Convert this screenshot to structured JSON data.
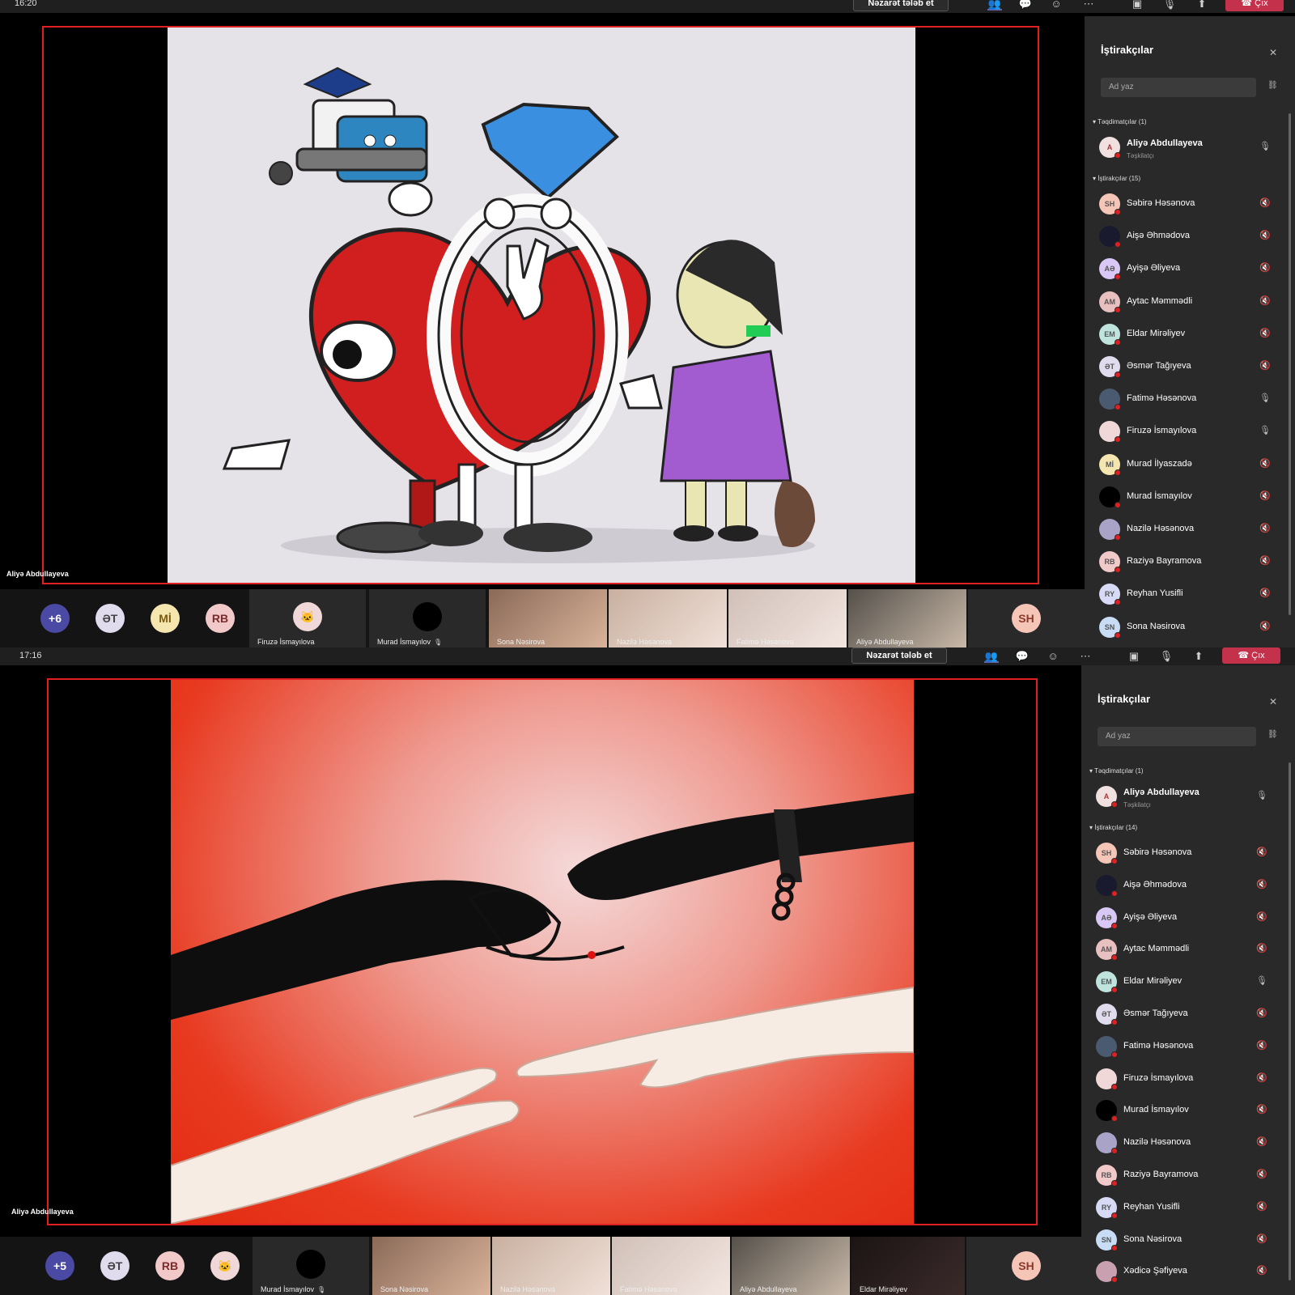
{
  "shot1": {
    "time": "16:20",
    "toolbar": {
      "request_control": "Nəzarət tələb et",
      "leave": "Çıx",
      "icons": [
        "people-icon",
        "chat-icon",
        "reactions-icon",
        "more-icon",
        "camera-off-icon",
        "mic-off-icon",
        "share-icon"
      ]
    },
    "presenter_label": "Aliyə Abdullayeva",
    "roster": {
      "overflow": "+6",
      "avatars": [
        "ƏT",
        "Mİ",
        "RB"
      ],
      "tiles": [
        {
          "name": "Firuzə İsmayılova"
        },
        {
          "name": "Murad İsmayılov"
        }
      ],
      "videos": [
        "Sona Nəsirova",
        "Nazilə Həsənova",
        "Fatimə Həsənova",
        "Aliyə Abdullayeva"
      ],
      "self": "SH"
    },
    "panel": {
      "title": "İştirakçılar",
      "search_placeholder": "Ad yaz",
      "presenters_header": "Təqdimatçılar (1)",
      "presenter": {
        "name": "Aliyə Abdullayeva",
        "role": "Təşkilatçı"
      },
      "attendees_header": "İştirakçılar (15)",
      "attendees": [
        {
          "initials": "SH",
          "name": "Səbirə Həsənova",
          "mic": "off",
          "color": "#f5c6b8"
        },
        {
          "initials": "",
          "name": "Aişə Əhmədova",
          "mic": "off",
          "color": "#1a1a2e"
        },
        {
          "initials": "AƏ",
          "name": "Ayişə Əliyeva",
          "mic": "off",
          "color": "#d9c8f5"
        },
        {
          "initials": "AM",
          "name": "Aytac Məmmədli",
          "mic": "off",
          "color": "#e8c0c0"
        },
        {
          "initials": "EM",
          "name": "Eldar Mirəliyev",
          "mic": "off",
          "color": "#bfe4dd"
        },
        {
          "initials": "ƏT",
          "name": "Əsmər Tağıyeva",
          "mic": "off",
          "color": "#e0dcee"
        },
        {
          "initials": "",
          "name": "Fatimə Həsənova",
          "mic": "on",
          "color": "#4a5a70"
        },
        {
          "initials": "",
          "name": "Firuzə İsmayılova",
          "mic": "on",
          "color": "#f0d8d8"
        },
        {
          "initials": "Mİ",
          "name": "Murad İlyaszadə",
          "mic": "off",
          "color": "#f5e6b0"
        },
        {
          "initials": "",
          "name": "Murad İsmayılov",
          "mic": "off",
          "color": "#000000"
        },
        {
          "initials": "",
          "name": "Nazilə Həsənova",
          "mic": "off",
          "color": "#a9a3c8"
        },
        {
          "initials": "RB",
          "name": "Raziyə Bayramova",
          "mic": "off",
          "color": "#f2c9c9"
        },
        {
          "initials": "RY",
          "name": "Reyhan Yusifli",
          "mic": "off",
          "color": "#d6daf5"
        },
        {
          "initials": "SN",
          "name": "Sona Nəsirova",
          "mic": "off",
          "color": "#c8dcf5"
        }
      ]
    }
  },
  "shot2": {
    "time": "17:16",
    "toolbar": {
      "request_control": "Nəzarət tələb et",
      "leave": "Çıx"
    },
    "presenter_label": "Aliyə Abdullayeva",
    "roster": {
      "overflow": "+5",
      "avatars": [
        "ƏT",
        "RB"
      ],
      "tiles": [
        {
          "name": "Murad İsmayılov"
        }
      ],
      "videos": [
        "Sona Nəsirova",
        "Nazilə Həsənova",
        "Fatimə Həsənova",
        "Aliyə Abdullayeva",
        "Eldar Mirəliyev"
      ],
      "self": "SH"
    },
    "panel": {
      "title": "İştirakçılar",
      "search_placeholder": "Ad yaz",
      "presenters_header": "Təqdimatçılar (1)",
      "presenter": {
        "name": "Aliyə Abdullayeva",
        "role": "Təşkilatçı"
      },
      "attendees_header": "İştirakçılar (14)",
      "attendees": [
        {
          "initials": "SH",
          "name": "Səbirə Həsənova",
          "mic": "off",
          "color": "#f5c6b8"
        },
        {
          "initials": "",
          "name": "Aişə Əhmədova",
          "mic": "off",
          "color": "#1a1a2e"
        },
        {
          "initials": "AƏ",
          "name": "Ayişə Əliyeva",
          "mic": "off",
          "color": "#d9c8f5"
        },
        {
          "initials": "AM",
          "name": "Aytac Məmmədli",
          "mic": "off",
          "color": "#e8c0c0"
        },
        {
          "initials": "EM",
          "name": "Eldar Mirəliyev",
          "mic": "on",
          "color": "#bfe4dd"
        },
        {
          "initials": "ƏT",
          "name": "Əsmər Tağıyeva",
          "mic": "off",
          "color": "#e0dcee"
        },
        {
          "initials": "",
          "name": "Fatimə Həsənova",
          "mic": "off",
          "color": "#4a5a70"
        },
        {
          "initials": "",
          "name": "Firuzə İsmayılova",
          "mic": "off",
          "color": "#f0d8d8"
        },
        {
          "initials": "",
          "name": "Murad İsmayılov",
          "mic": "off",
          "color": "#000000"
        },
        {
          "initials": "",
          "name": "Nazilə Həsənova",
          "mic": "off",
          "color": "#a9a3c8"
        },
        {
          "initials": "RB",
          "name": "Raziyə Bayramova",
          "mic": "off",
          "color": "#f2c9c9"
        },
        {
          "initials": "RY",
          "name": "Reyhan Yusifli",
          "mic": "off",
          "color": "#d6daf5"
        },
        {
          "initials": "SN",
          "name": "Sona Nəsirova",
          "mic": "off",
          "color": "#c8dcf5"
        },
        {
          "initials": "",
          "name": "Xədicə Şəfiyeva",
          "mic": "off",
          "color": "#c9a0b0"
        }
      ]
    }
  }
}
